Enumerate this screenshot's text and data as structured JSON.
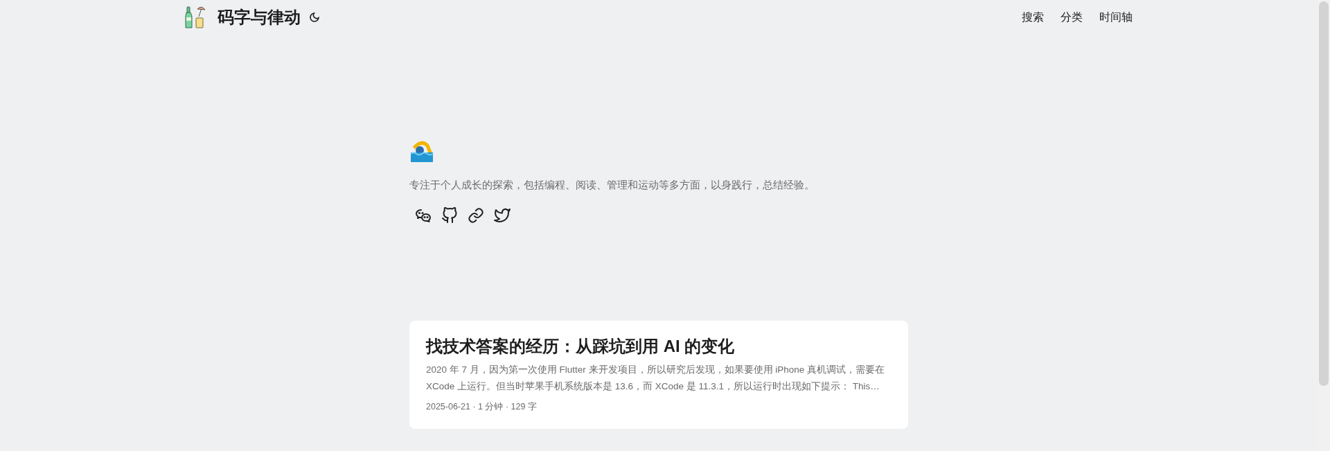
{
  "header": {
    "site_title": "码字与律动",
    "nav": [
      {
        "label": "搜索"
      },
      {
        "label": "分类"
      },
      {
        "label": "时间轴"
      }
    ]
  },
  "profile": {
    "description": "专注于个人成长的探索，包括编程、阅读、管理和运动等多方面，以身践行，总结经验。",
    "socials": [
      {
        "kind": "wechat"
      },
      {
        "kind": "github"
      },
      {
        "kind": "link"
      },
      {
        "kind": "twitter"
      }
    ]
  },
  "posts": [
    {
      "title": "找技术答案的经历：从踩坑到用 AI 的变化",
      "excerpt": "2020 年 7 月，因为第一次使用 Flutter 来开发项目，所以研究后发现，如果要使用 iPhone 真机调试，需要在 XCode 上运行。但当时苹果手机系统版本是 13.6，而 XCode 是 11.3.1，所以运行时出现如下提示： This…",
      "meta": "2025-06-21 · 1 分钟 · 129 字"
    }
  ]
}
